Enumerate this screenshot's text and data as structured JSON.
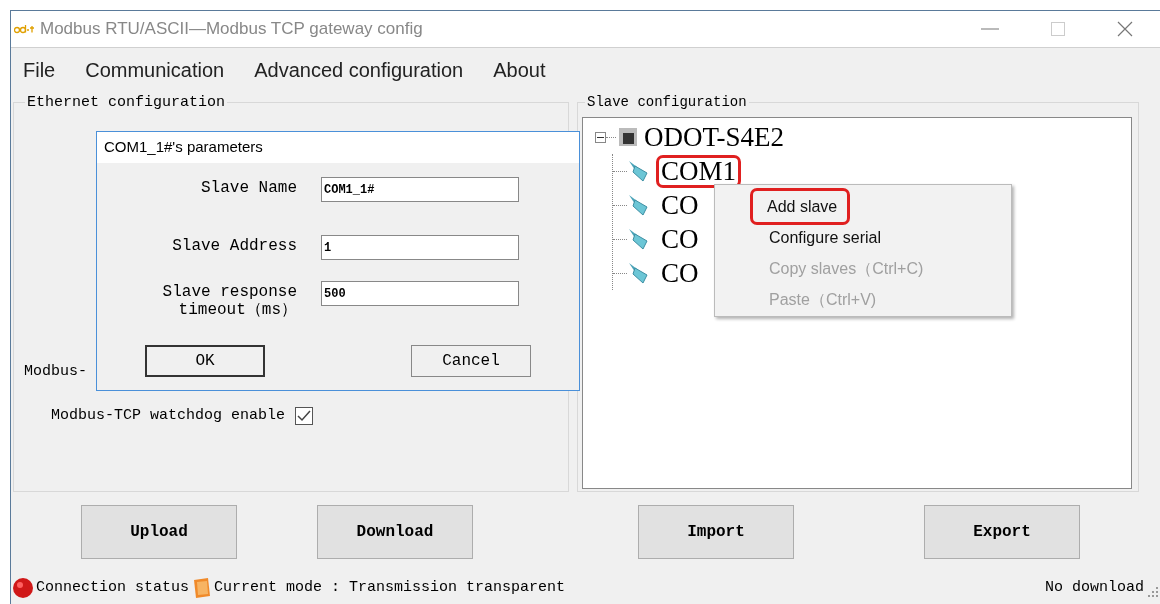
{
  "window": {
    "title": "Modbus RTU/ASCII—Modbus TCP gateway config"
  },
  "menu": [
    "File",
    "Communication",
    "Advanced configuration",
    "About"
  ],
  "ethernet_config": {
    "title": "Ethernet configuration",
    "partial_label": "Modbus-",
    "watchdog": {
      "label": "Modbus-TCP watchdog enable",
      "checked": true
    }
  },
  "slave_config": {
    "title": "Slave configuration",
    "tree": [
      {
        "label": "ODOT-S4E2",
        "expanded": true,
        "highlighted": false,
        "children": [
          {
            "label": "COM1",
            "highlighted": true
          },
          {
            "label": "CO",
            "highlighted": false
          },
          {
            "label": "CO",
            "highlighted": false
          },
          {
            "label": "CO",
            "highlighted": false
          }
        ]
      }
    ]
  },
  "buttons": [
    "Upload",
    "Download",
    "Import",
    "Export"
  ],
  "status_bar": {
    "connection": "Connection status",
    "mode": "Current mode : Transmission transparent",
    "download": "No download"
  },
  "dialog": {
    "title": "COM1_1#'s parameters",
    "fields": [
      {
        "label": "Slave Name",
        "value": "COM1_1#"
      },
      {
        "label": "Slave Address",
        "value": "1"
      },
      {
        "label": "Slave response\ntimeout（ms）",
        "value": "500"
      }
    ],
    "buttons": [
      {
        "label": "OK",
        "default": true
      },
      {
        "label": "Cancel",
        "default": false
      }
    ]
  },
  "context_menu": [
    {
      "label": "Add slave",
      "disabled": false,
      "highlighted": true
    },
    {
      "label": "Configure serial",
      "disabled": false,
      "highlighted": false
    },
    {
      "label": "Copy slaves（Ctrl+C)",
      "disabled": true,
      "highlighted": false
    },
    {
      "label": "Paste（Ctrl+V)",
      "disabled": true,
      "highlighted": false
    }
  ]
}
